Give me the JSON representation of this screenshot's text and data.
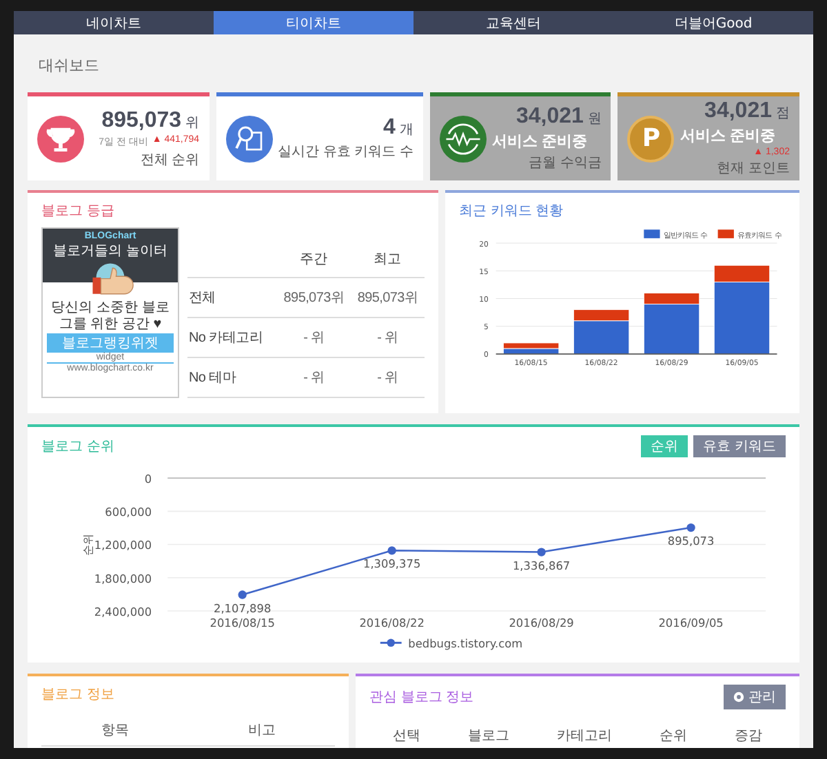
{
  "tabs": [
    {
      "label": "네이차트",
      "selected": false
    },
    {
      "label": "티이차트",
      "selected": true
    },
    {
      "label": "교육센터",
      "selected": false
    },
    {
      "label": "더블어Good",
      "selected": false
    }
  ],
  "page_title": "대쉬보드",
  "stat_cards": [
    {
      "kind": "trophy",
      "color": "#e8566f",
      "value": "895,073",
      "unit": "위",
      "sub_label": "7일 전 대비",
      "change": "▲ 441,794",
      "label": "전체 순위",
      "disabled": false
    },
    {
      "kind": "search-doc",
      "color": "#4a7bd8",
      "value": "4",
      "unit": "개",
      "label": "실시간 유효 키워드 수",
      "disabled": false
    },
    {
      "kind": "wave",
      "color": "#2e7d32",
      "value": "34,021",
      "unit": "원",
      "overlay": "서비스 준비중",
      "label": "금월 수익금",
      "disabled": true
    },
    {
      "kind": "coin",
      "icon_text": "P",
      "color": "#c8902c",
      "value": "34,021",
      "unit": "점",
      "change": "▲ 1,302",
      "overlay": "서비스 준비중",
      "label": "현재 포인트",
      "disabled": true
    }
  ],
  "blog_grade": {
    "title": "블로그 등급",
    "widget": {
      "logo": "BLOGchart",
      "headline": "블로거들의 놀이터",
      "text": "당신의 소중한 블로그를 위한 공간 ♥",
      "button": "블로그랭킹위젯",
      "caption": "widget",
      "url": "www.blogchart.co.kr"
    },
    "columns": [
      "주간",
      "최고"
    ],
    "rows": [
      {
        "label": "전체",
        "cells": [
          "895,073위",
          "895,073위"
        ]
      },
      {
        "label": "No 카테고리",
        "cells": [
          "- 위",
          "- 위"
        ]
      },
      {
        "label": "No 테마",
        "cells": [
          "- 위",
          "- 위"
        ]
      }
    ]
  },
  "keyword_status": {
    "title": "최근 키워드 현황",
    "chart_data": {
      "type": "bar",
      "stacked": true,
      "categories": [
        "16/08/15",
        "16/08/22",
        "16/08/29",
        "16/09/05"
      ],
      "ylim": [
        0,
        20
      ],
      "yticks": [
        0,
        5,
        10,
        15,
        20
      ],
      "grid": true,
      "legend": "top-right",
      "series": [
        {
          "name": "일반키워드 수",
          "color": "#3366cc",
          "values": [
            1,
            6,
            9,
            13
          ]
        },
        {
          "name": "유효키워드 수",
          "color": "#dc3912",
          "values": [
            1,
            2,
            2,
            3
          ]
        }
      ]
    }
  },
  "blog_rank": {
    "title": "블로그 순위",
    "buttons": [
      {
        "label": "순위",
        "selected": true
      },
      {
        "label": "유효 키워드",
        "selected": false
      }
    ],
    "chart_data": {
      "type": "line",
      "ylabel": "순위",
      "x": [
        "2016/08/15",
        "2016/08/22",
        "2016/08/29",
        "2016/09/05"
      ],
      "ylim": [
        2400000,
        0
      ],
      "grid": true,
      "legend": "bottom",
      "yticks": [
        {
          "value": 0,
          "label": "0"
        },
        {
          "value": 600000,
          "label": "600,000"
        },
        {
          "value": 1200000,
          "label": "1,200,000"
        },
        {
          "value": 1800000,
          "label": "1,800,000"
        },
        {
          "value": 2400000,
          "label": "2,400,000"
        }
      ],
      "value_labels": [
        "2,107,898",
        "1,309,375",
        "1,336,867",
        "895,073"
      ],
      "series": [
        {
          "name": "bedbugs.tistory.com",
          "color": "#3f65c8",
          "marker": "circle",
          "values": [
            2107898,
            1309375,
            1336867,
            895073
          ]
        }
      ]
    }
  },
  "blog_info": {
    "title": "블로그 정보",
    "columns": [
      "항목",
      "비고"
    ]
  },
  "watched_blogs": {
    "title": "관심 블로그 정보",
    "manage_button": "관리",
    "columns": [
      "선택",
      "블로그",
      "카테고리",
      "순위",
      "증감"
    ]
  }
}
